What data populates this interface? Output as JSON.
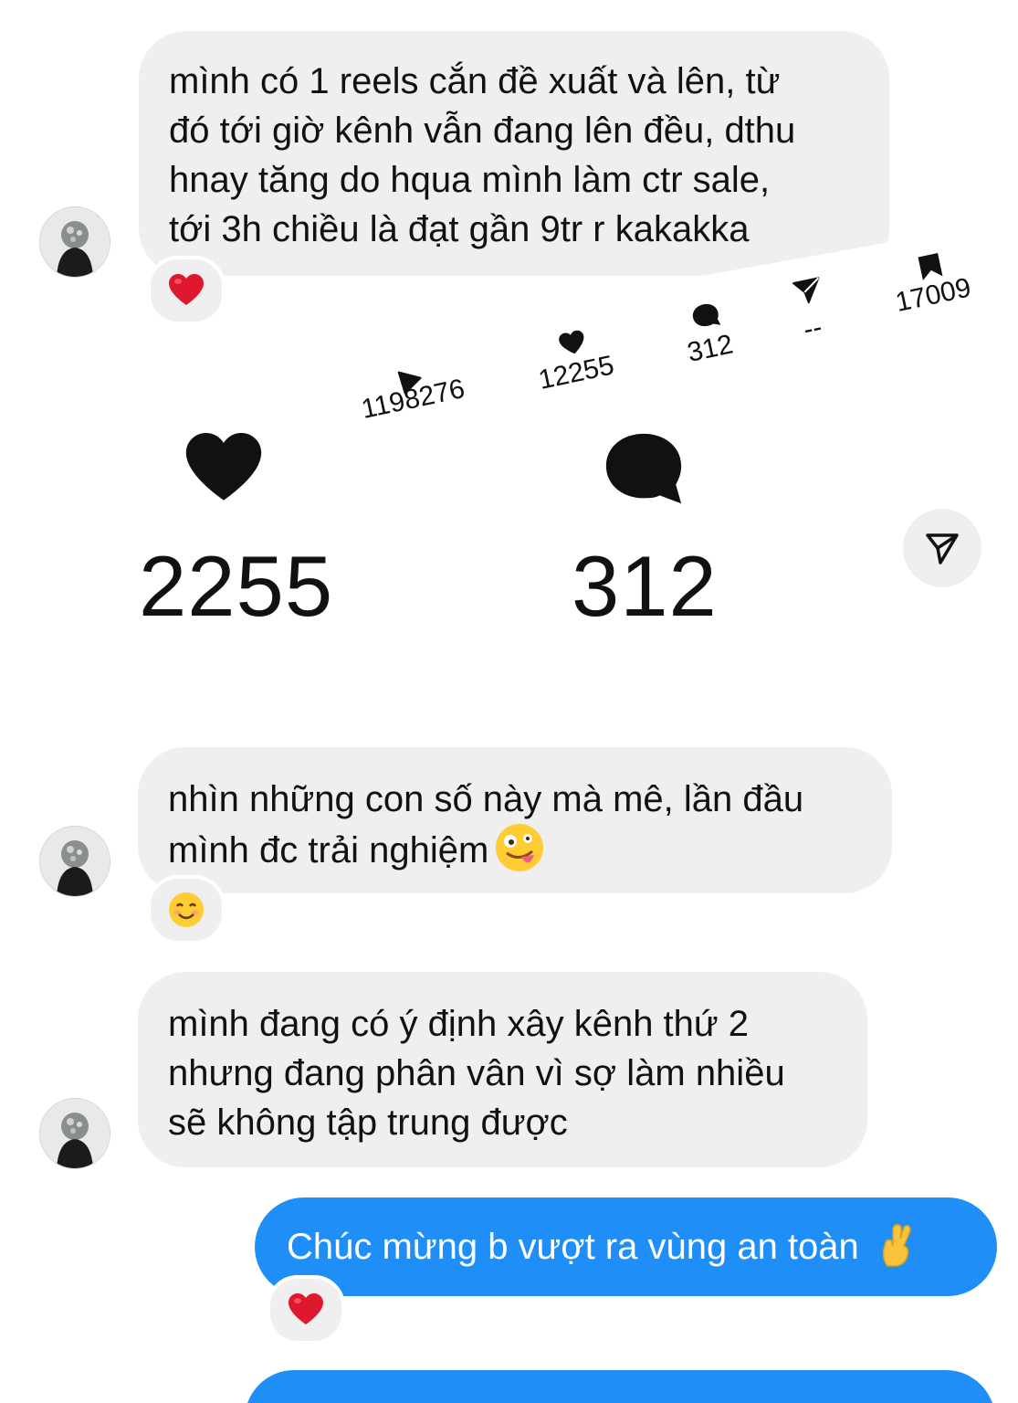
{
  "messages": [
    {
      "lines": [
        "mình có 1 reels cắn đề xuất và lên, từ",
        "đó tới giờ kênh vẫn đang lên đều, dthu",
        "hnay tăng do hqua mình làm ctr sale,",
        "tới 3h chiều là đạt gần 9tr r kakakka"
      ],
      "reaction": "heart-emoji"
    },
    {
      "lines": [
        "nhìn những con số này mà mê, lần đầu",
        "mình đc trải nghiệm"
      ],
      "inline_emoji": "zany-face-emoji",
      "reaction": "smiling-face-emoji"
    },
    {
      "lines": [
        "mình đang có ý định xây kênh thứ 2",
        "nhưng đang phân vân vì sợ làm nhiều",
        "sẽ không tập trung được"
      ]
    }
  ],
  "reel_stats": {
    "plays": "1198276",
    "likes": "12255",
    "comments": "312",
    "shares": "--",
    "saves": "17009"
  },
  "big_stats": {
    "likes": "2255",
    "comments": "312"
  },
  "outgoing": [
    {
      "text": "Chúc mừng b vượt ra vùng an toàn",
      "inline_emoji": "crossed-fingers-emoji",
      "reaction": "heart-emoji"
    }
  ],
  "colors": {
    "incoming_bubble": "#efefef",
    "outgoing_bubble": "#1f8ef7",
    "heart": "#e0182d"
  }
}
